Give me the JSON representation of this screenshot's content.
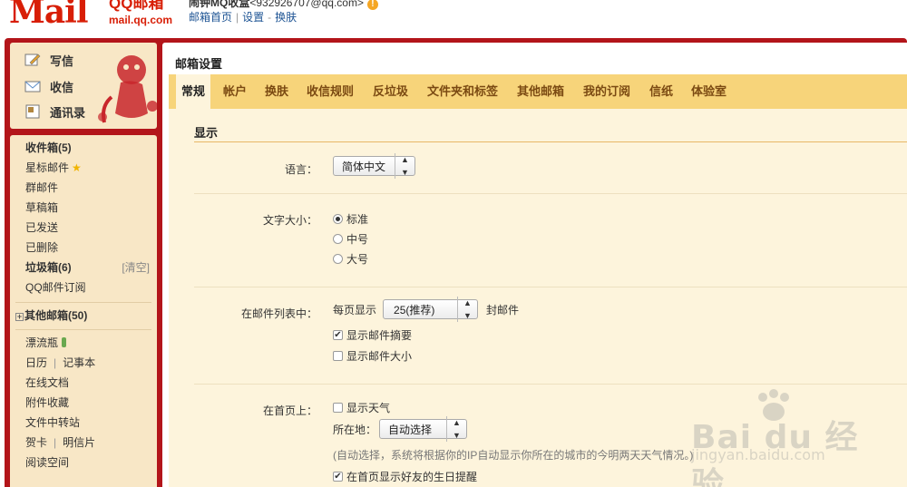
{
  "header": {
    "logo_text": "Mail",
    "brand_qq": "QQ邮箱",
    "brand_domain": "mail.qq.com",
    "user_name": "闹钟MQ收盒",
    "user_addr": "<932926707@qq.com>",
    "links": [
      "邮箱首页",
      "设置",
      "换肤"
    ]
  },
  "compose": {
    "write": "写信",
    "receive": "收信",
    "contacts": "通讯录"
  },
  "folders": {
    "inbox": "收件箱(5)",
    "starred": "星标邮件",
    "group": "群邮件",
    "drafts": "草稿箱",
    "sent": "已发送",
    "deleted": "已删除",
    "spam": "垃圾箱(6)",
    "spam_clear": "[清空]",
    "subscriptions": "QQ邮件订阅",
    "other": "其他邮箱(50)",
    "drift": "漂流瓶",
    "calendar": "日历",
    "notes": "记事本",
    "docs": "在线文档",
    "attachments": "附件收藏",
    "transfer": "文件中转站",
    "cards": "贺卡",
    "postcards": "明信片",
    "reading": "阅读空间"
  },
  "main": {
    "title": "邮箱设置",
    "tabs": [
      "常规",
      "帐户",
      "换肤",
      "收信规则",
      "反垃圾",
      "文件夹和标签",
      "其他邮箱",
      "我的订阅",
      "信纸",
      "体验室"
    ],
    "active_tab": "常规",
    "section": "显示",
    "language": {
      "label": "语言：",
      "value": "简体中文"
    },
    "font_size": {
      "label": "文字大小：",
      "options": [
        "标准",
        "中号",
        "大号"
      ],
      "selected": "标准"
    },
    "mail_list": {
      "label": "在邮件列表中：",
      "per_page_prefix": "每页显示",
      "per_page_value": "25(推荐)",
      "per_page_suffix": "封邮件",
      "show_summary": "显示邮件摘要",
      "show_summary_checked": true,
      "show_size": "显示邮件大小",
      "show_size_checked": false
    },
    "homepage": {
      "label": "在首页上：",
      "show_weather": "显示天气",
      "show_weather_checked": false,
      "location_label": "所在地：",
      "location_value": "自动选择",
      "location_hint": "(自动选择，系统将根据你的IP自动显示你所在的城市的今明两天天气情况。)",
      "birthday": "在首页显示好友的生日提醒",
      "birthday_checked": true
    }
  },
  "watermark": {
    "brand": "Bai du 经验",
    "url": "jingyan.baidu.com"
  },
  "colors": {
    "frame_red": "#b3151a",
    "tab_bar": "#f7d47a",
    "panel_cream": "#fdf4dc",
    "link_blue": "#1e5494"
  }
}
